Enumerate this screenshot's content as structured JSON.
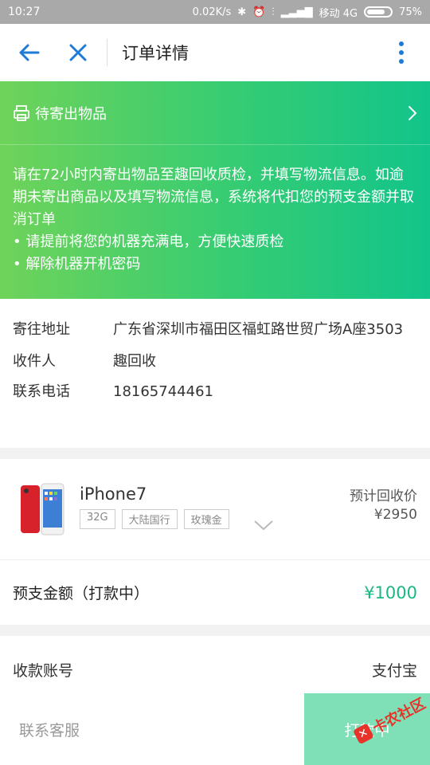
{
  "status_bar": {
    "time": "10:27",
    "speed": "0.02K/s",
    "carrier": "移动 4G",
    "battery": "75%"
  },
  "navbar": {
    "title": "订单详情"
  },
  "banner": {
    "status_label": "待寄出物品",
    "notice": "请在72小时内寄出物品至趣回收质检，并填写物流信息。如逾期未寄出商品以及填写物流信息，系统将代扣您的预支金额并取消订单",
    "tips": [
      "• 请提前将您的机器充满电，方便快速质检",
      "• 解除机器开机密码"
    ]
  },
  "address": {
    "ship_to_label": "寄往地址",
    "ship_to_value": "广东省深圳市福田区福虹路世贸广场A座3503",
    "receiver_label": "收件人",
    "receiver_value": "趣回收",
    "phone_label": "联系电话",
    "phone_value": "18165744461"
  },
  "product": {
    "name": "iPhone7",
    "tags": [
      "32G",
      "大陆国行",
      "玫瑰金"
    ],
    "est_price_label": "预计回收价",
    "est_price": "¥2950"
  },
  "advance": {
    "label": "预支金额（打款中）",
    "amount": "¥1000"
  },
  "account": {
    "label": "收款账号",
    "value": "支付宝"
  },
  "bottom_bar": {
    "service_label": "联系客服",
    "primary_label": "打款中"
  },
  "watermark": {
    "text": "卡农社区"
  },
  "colors": {
    "accent": "#19b883",
    "nav_icon": "#1e7bd8",
    "banner_start": "#6fd35a",
    "banner_end": "#12c48a",
    "button": "#7fe0b7"
  }
}
